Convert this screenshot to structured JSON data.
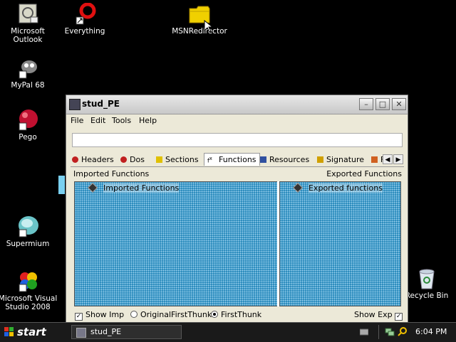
{
  "desktop": {
    "icons": [
      {
        "label_line1": "Microsoft",
        "label_line2": "Outlook",
        "icon": "outlook-icon"
      },
      {
        "label_line1": "Everything",
        "label_line2": "",
        "icon": "everything-icon"
      },
      {
        "label_line1": "MSNRedirector",
        "label_line2": "",
        "icon": "folder-icon"
      },
      {
        "label_line1": "MyPal 68",
        "label_line2": "",
        "icon": "mypal-icon"
      },
      {
        "label_line1": "Pego",
        "label_line2": "",
        "icon": "pego-icon"
      },
      {
        "label_line1": "Supermium",
        "label_line2": "",
        "icon": "supermium-icon"
      },
      {
        "label_line1": "Microsoft Visual",
        "label_line2": "Studio 2008",
        "icon": "visual-studio-icon"
      },
      {
        "label_line1": "Recycle Bin",
        "label_line2": "",
        "icon": "recycle-bin-icon"
      }
    ]
  },
  "window": {
    "title": "stud_PE",
    "menu": [
      "File",
      "Edit",
      "Tools",
      "Help"
    ],
    "tabs": [
      "Headers",
      "Dos",
      "Sections",
      "Functions",
      "Resources",
      "Signature",
      "F"
    ],
    "active_tab": "Functions",
    "left_section_label": "Imported Functions",
    "right_section_label": "Exported Functions",
    "left_pane_header": "Imported Functions",
    "right_pane_header": "Exported functions",
    "bottom": {
      "show_imp": "Show Imp",
      "original_first_thunk": "OriginalFirstThunk",
      "first_thunk": "FirstThunk",
      "show_exp": "Show Exp",
      "show_imp_checked": true,
      "first_thunk_selected": true,
      "show_exp_checked": true
    }
  },
  "taskbar": {
    "start": "start",
    "task": "stud_PE",
    "time": "6:04 PM"
  }
}
